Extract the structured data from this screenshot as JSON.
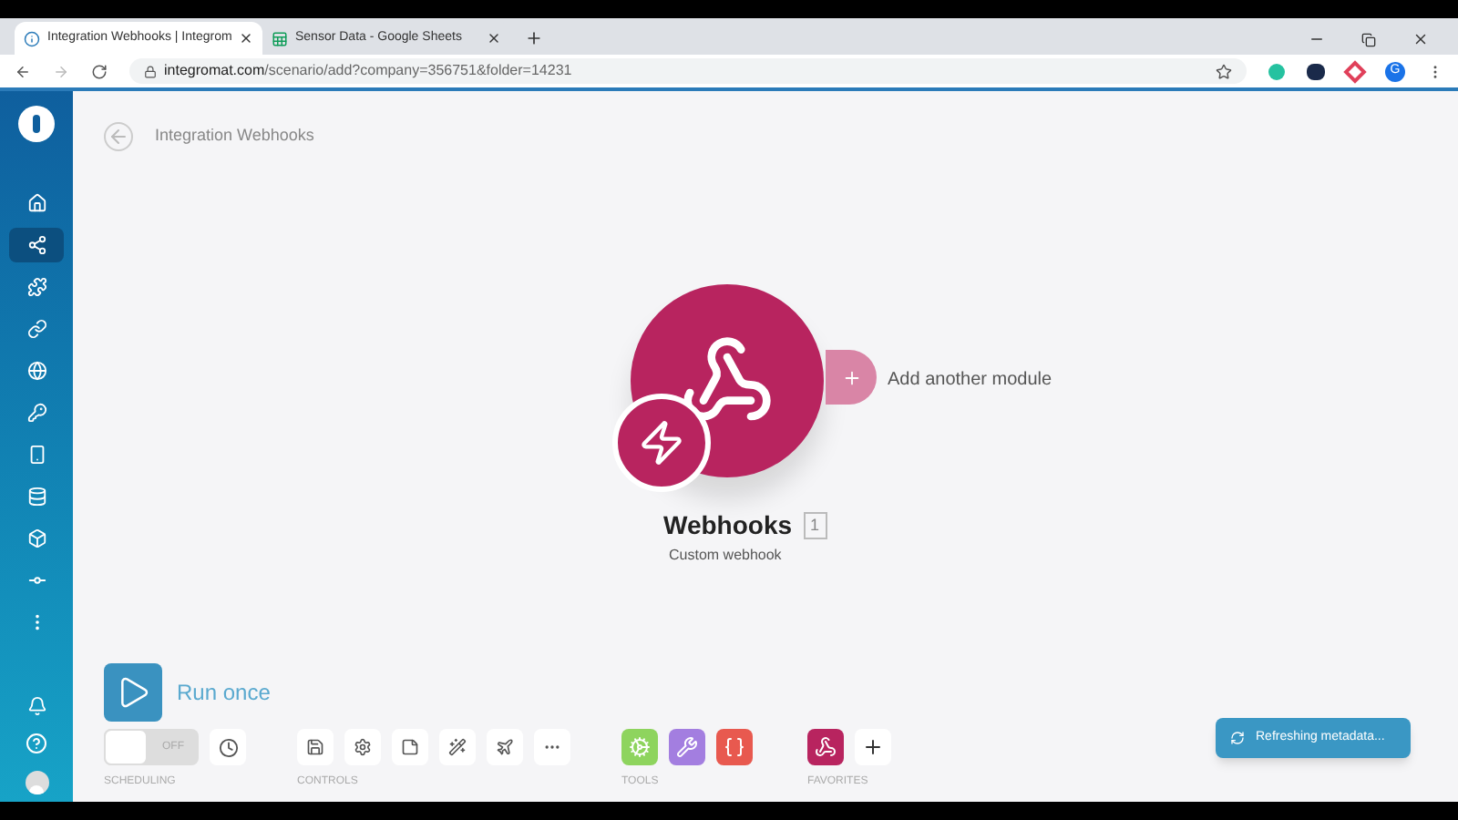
{
  "browser": {
    "tabs": [
      {
        "title": "Integration Webhooks | Integrom",
        "kind": "integromat",
        "selected": true
      },
      {
        "title": "Sensor Data - Google Sheets",
        "kind": "sheets",
        "selected": false
      }
    ],
    "url_host": "integromat.com",
    "url_path": "/scenario/add?company=356751&folder=14231",
    "profile_initial": "G"
  },
  "sidebar": {
    "items": [
      {
        "kind": "home",
        "selected": false
      },
      {
        "kind": "share",
        "selected": true
      },
      {
        "kind": "puzzle",
        "selected": false
      },
      {
        "kind": "link",
        "selected": false
      },
      {
        "kind": "globe",
        "selected": false
      },
      {
        "kind": "key",
        "selected": false
      },
      {
        "kind": "phone",
        "selected": false
      },
      {
        "kind": "database",
        "selected": false
      },
      {
        "kind": "box",
        "selected": false
      },
      {
        "kind": "commit",
        "selected": false
      },
      {
        "kind": "more",
        "selected": false
      }
    ],
    "bottom_items": [
      {
        "kind": "bell"
      },
      {
        "kind": "help"
      },
      {
        "kind": "avatar"
      }
    ]
  },
  "breadcrumb": "Integration Webhooks",
  "module": {
    "name": "Webhooks",
    "count": "1",
    "subtitle": "Custom webhook"
  },
  "add_module": "Add another module",
  "run_once": "Run once",
  "scheduling": {
    "label": "SCHEDULING",
    "switch_text": "OFF",
    "on": false
  },
  "controls": {
    "label": "CONTROLS",
    "buttons": [
      {
        "kind": "save"
      },
      {
        "kind": "settings"
      },
      {
        "kind": "note"
      },
      {
        "kind": "wand"
      },
      {
        "kind": "plane"
      },
      {
        "kind": "more"
      }
    ]
  },
  "tools": {
    "label": "TOOLS",
    "buttons": [
      {
        "kind": "gear",
        "color": "#8ed45e"
      },
      {
        "kind": "tools",
        "color": "#a37ee0"
      },
      {
        "kind": "brackets",
        "color": "#e8594f"
      }
    ]
  },
  "favorites": {
    "label": "FAVORITES",
    "buttons": [
      {
        "kind": "webhook",
        "color": "#b8245f"
      },
      {
        "kind": "add",
        "color": "#ffffff"
      }
    ]
  },
  "toast": "Refreshing metadata..."
}
